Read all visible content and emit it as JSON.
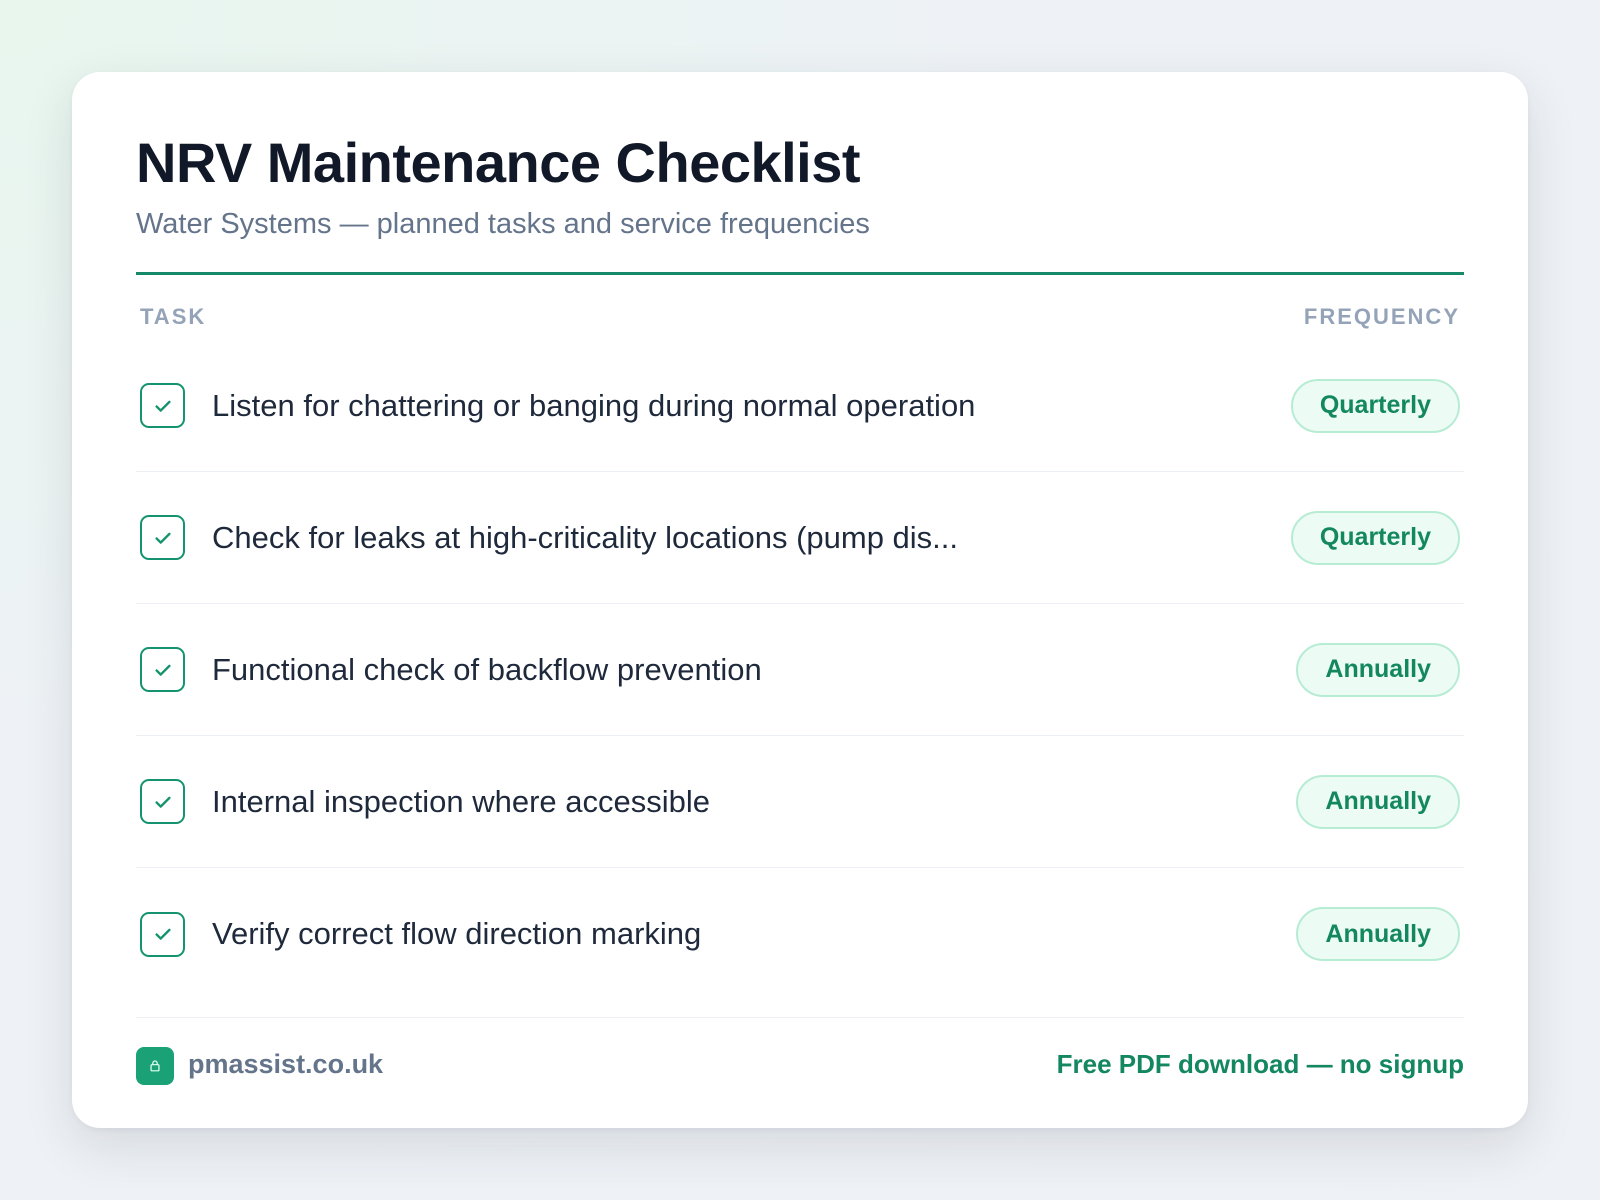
{
  "header": {
    "title": "NRV Maintenance Checklist",
    "subtitle": "Water Systems — planned tasks and service frequencies"
  },
  "table": {
    "columns": {
      "task": "TASK",
      "frequency": "FREQUENCY"
    },
    "rows": [
      {
        "task": "Listen for chattering or banging during normal operation",
        "frequency": "Quarterly",
        "checked": true
      },
      {
        "task": "Check for leaks at high-criticality locations (pump dis...",
        "frequency": "Quarterly",
        "checked": true
      },
      {
        "task": "Functional check of backflow prevention",
        "frequency": "Annually",
        "checked": true
      },
      {
        "task": "Internal inspection where accessible",
        "frequency": "Annually",
        "checked": true
      },
      {
        "task": "Verify correct flow direction marking",
        "frequency": "Annually",
        "checked": true
      }
    ]
  },
  "footer": {
    "site": "pmassist.co.uk",
    "logo_icon": "lock-icon",
    "cta": "Free PDF download — no signup"
  },
  "colors": {
    "accent": "#15896a",
    "badge_bg": "#ecfbf4",
    "badge_border": "#b7ecd4",
    "title": "#111827",
    "muted": "#64748b"
  }
}
